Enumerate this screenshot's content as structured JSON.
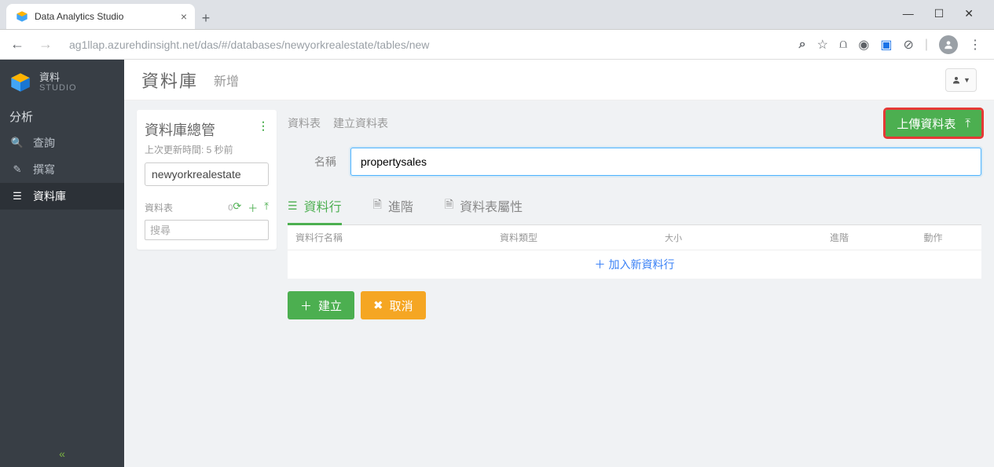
{
  "browser": {
    "tab_title": "Data Analytics Studio",
    "url": "ag1llap.azurehdinsight.net/das/#/databases/newyorkrealestate/tables/new"
  },
  "brand": {
    "line1": "資料",
    "line2": "STUDIO"
  },
  "sidebar": {
    "section": "分析",
    "items": [
      {
        "label": "查詢"
      },
      {
        "label": "撰寫"
      },
      {
        "label": "資料庫"
      }
    ]
  },
  "header": {
    "title": "資料庫",
    "sub": "新增"
  },
  "db_panel": {
    "title": "資料庫總管",
    "updated": "上次更新時間: 5 秒前",
    "selected_db": "newyorkrealestate",
    "tables_label": "資料表",
    "tables_count": "0",
    "search_placeholder": "搜尋"
  },
  "form": {
    "crumb1": "資料表",
    "crumb2": "建立資料表",
    "upload_label": "上傳資料表",
    "name_label": "名稱",
    "name_value": "propertysales",
    "tabs": [
      {
        "label": "資料行"
      },
      {
        "label": "進階"
      },
      {
        "label": "資料表屬性"
      }
    ],
    "grid_headers": {
      "name": "資料行名稱",
      "type": "資料類型",
      "size": "大小",
      "advanced": "進階",
      "action": "動作"
    },
    "add_row": "加入新資料行",
    "create": "建立",
    "cancel": "取消"
  }
}
